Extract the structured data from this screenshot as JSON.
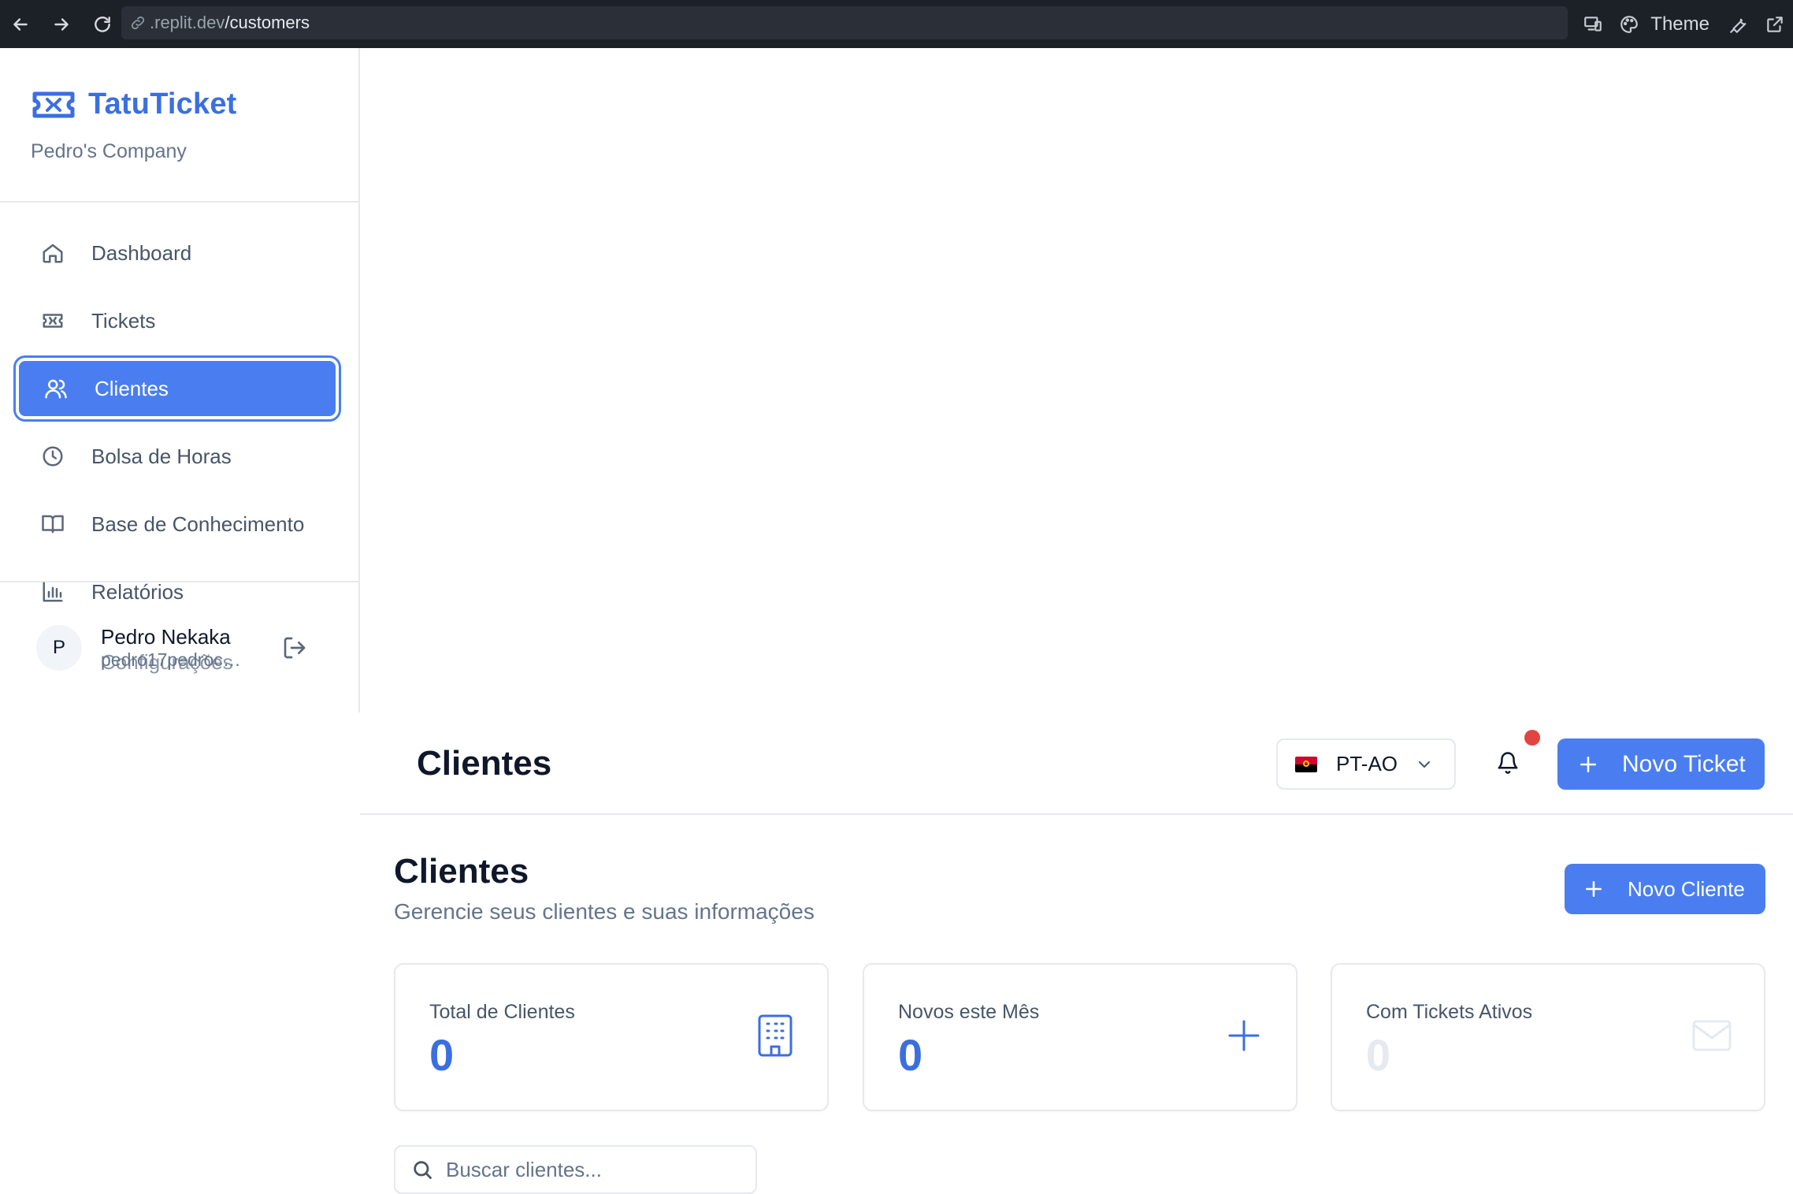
{
  "browser": {
    "url_host": ".replit.dev",
    "url_path": "/customers",
    "theme_label": "Theme"
  },
  "sidebar": {
    "brand": "TatuTicket",
    "company": "Pedro's Company",
    "items": [
      {
        "label": "Dashboard",
        "icon": "home-icon"
      },
      {
        "label": "Tickets",
        "icon": "ticket-icon"
      },
      {
        "label": "Clientes",
        "icon": "users-icon",
        "active": true
      },
      {
        "label": "Bolsa de Horas",
        "icon": "clock-icon"
      },
      {
        "label": "Base de Conhecimento",
        "icon": "book-icon"
      },
      {
        "label": "Relatórios",
        "icon": "bar-chart-icon"
      },
      {
        "label": "Configurações",
        "icon": "gear-icon"
      }
    ],
    "user": {
      "initial": "P",
      "name": "Pedro Nekaka",
      "email": "pedro17pedroc@..."
    }
  },
  "header": {
    "title": "Clientes",
    "language": "PT-AO",
    "new_ticket": "Novo Ticket",
    "has_notification": true
  },
  "main": {
    "title": "Clientes",
    "subtitle": "Gerencie seus clientes e suas informações",
    "new_client": "Novo Cliente",
    "stats": [
      {
        "label": "Total de Clientes",
        "value": "0",
        "icon": "building-icon"
      },
      {
        "label": "Novos este Mês",
        "value": "0",
        "icon": "plus-icon"
      },
      {
        "label": "Com Tickets Ativos",
        "value": "0",
        "icon": "mail-icon"
      }
    ],
    "search_placeholder": "Buscar clientes..."
  },
  "colors": {
    "accent": "#4a7ef0",
    "brand": "#3b6fe0",
    "notification": "#e0463f"
  }
}
